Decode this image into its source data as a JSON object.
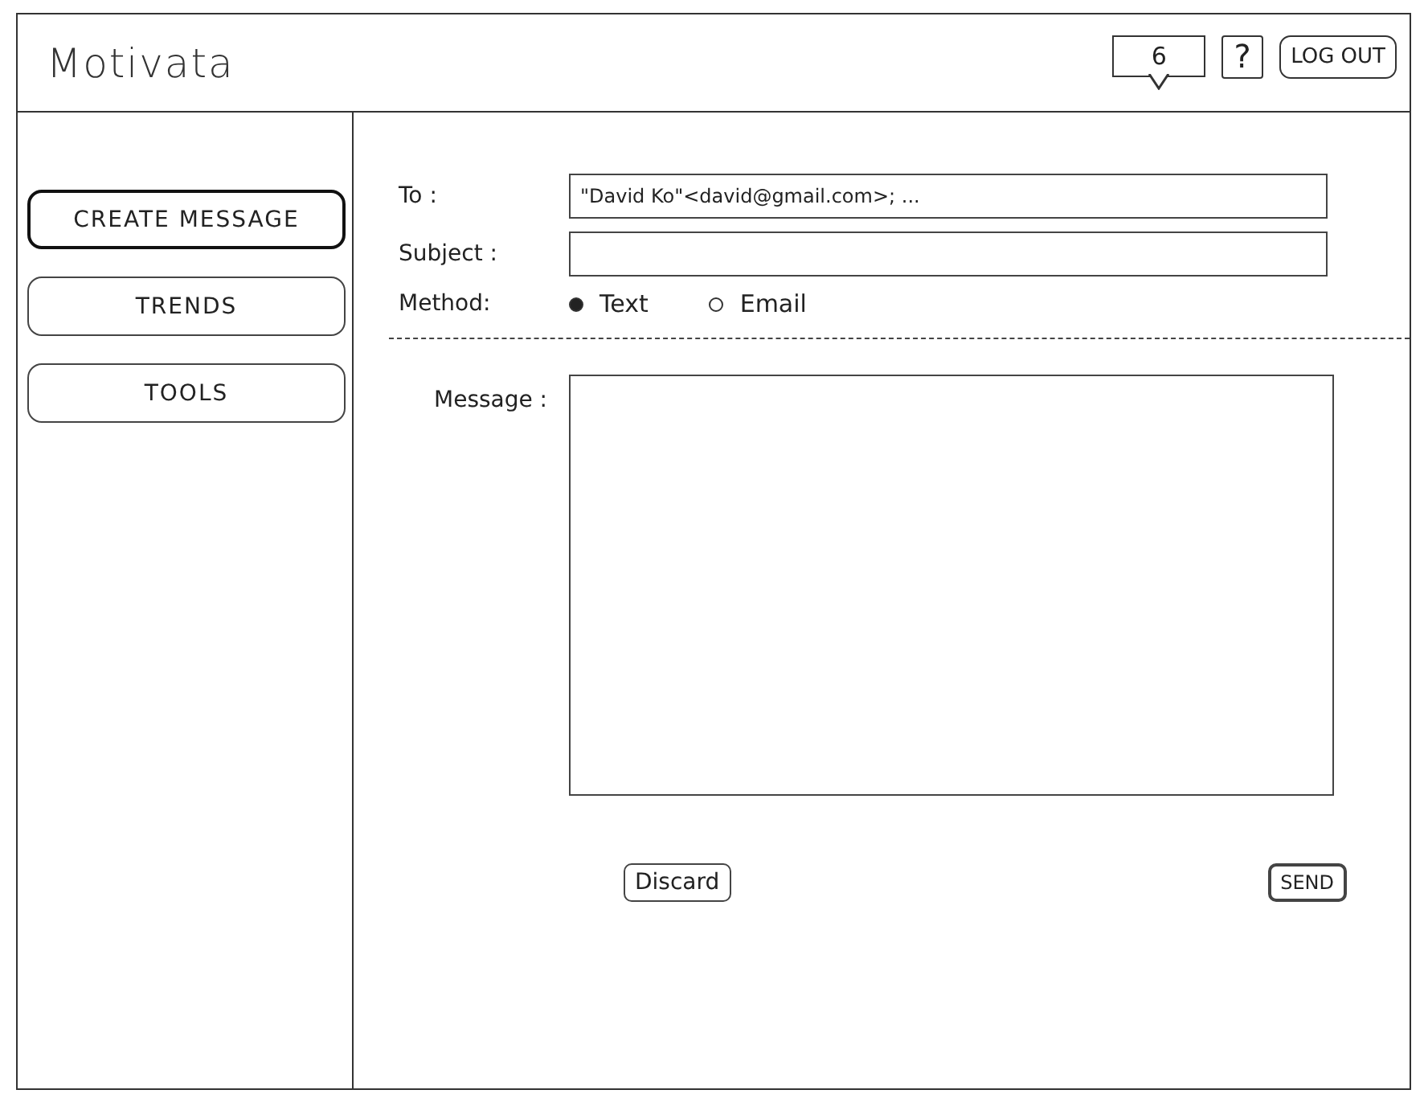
{
  "app": {
    "title": "Motivata"
  },
  "header": {
    "notifications": "6",
    "help": "?",
    "logout": "LOG OUT"
  },
  "nav": [
    {
      "label": "CREATE MESSAGE",
      "selected": true
    },
    {
      "label": "TRENDS",
      "selected": false
    },
    {
      "label": "TOOLS",
      "selected": false
    }
  ],
  "compose": {
    "to": {
      "label": "To :",
      "value": "\"David Ko\"<david@gmail.com>; ..."
    },
    "subject": {
      "label": "Subject :"
    },
    "method": {
      "label": "Method:",
      "options": [
        {
          "label": "Text",
          "selected": true
        },
        {
          "label": "Email",
          "selected": false
        }
      ]
    },
    "message": {
      "label": "Message :"
    },
    "discard": "Discard",
    "send": "SEND"
  }
}
